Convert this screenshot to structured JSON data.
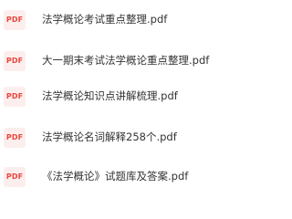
{
  "icon": {
    "name": "pdf-file-icon",
    "label": "PDF",
    "color": "#e8473d",
    "background": "#fdeeee"
  },
  "files": [
    {
      "name": "法学概论考试重点整理.pdf"
    },
    {
      "name": "大一期末考试法学概论重点整理.pdf"
    },
    {
      "name": "法学概论知识点讲解梳理.pdf"
    },
    {
      "name": "法学概论名词解释258个.pdf"
    },
    {
      "name": "《法学概论》试题库及答案.pdf"
    }
  ]
}
